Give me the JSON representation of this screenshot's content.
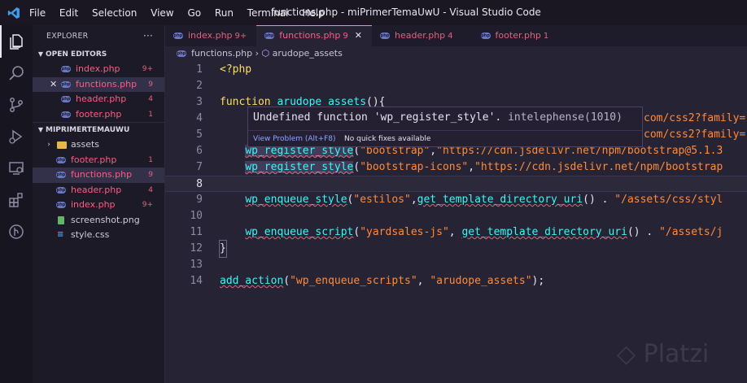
{
  "window": {
    "title": "functions.php - miPrimerTemaUwU - Visual Studio Code"
  },
  "menu": [
    "File",
    "Edit",
    "Selection",
    "View",
    "Go",
    "Run",
    "Terminal",
    "Help"
  ],
  "sidebar": {
    "title": "EXPLORER",
    "more": "···",
    "open_editors_label": "OPEN EDITORS",
    "open_editors": [
      {
        "name": "index.php",
        "badge": "9+"
      },
      {
        "name": "functions.php",
        "badge": "9"
      },
      {
        "name": "header.php",
        "badge": "4"
      },
      {
        "name": "footer.php",
        "badge": "1"
      }
    ],
    "project_label": "MIPRIMERTEMAUWU",
    "folder": "assets",
    "files": [
      {
        "name": "footer.php",
        "badge": "1"
      },
      {
        "name": "functions.php",
        "badge": "9"
      },
      {
        "name": "header.php",
        "badge": "4"
      },
      {
        "name": "index.php",
        "badge": "9+"
      },
      {
        "name": "screenshot.png",
        "badge": ""
      },
      {
        "name": "style.css",
        "badge": ""
      }
    ]
  },
  "tabs": [
    {
      "name": "index.php",
      "badge": "9+"
    },
    {
      "name": "functions.php",
      "badge": "9"
    },
    {
      "name": "header.php",
      "badge": "4"
    },
    {
      "name": "footer.php",
      "badge": "1"
    }
  ],
  "breadcrumb": {
    "file": "functions.php",
    "symbol": "arudope_assets"
  },
  "editor": {
    "line_numbers": [
      "1",
      "2",
      "3",
      "4",
      "5",
      "6",
      "7",
      "8",
      "9",
      "10",
      "11",
      "12",
      "13",
      "14"
    ],
    "l1": "<?php",
    "l3_kw": "function",
    "l3_name": "arudope_assets",
    "l3_rest": "(){",
    "l4_tail": "com/css2?family=",
    "l5_tail": "com/css2?family=",
    "l6_fn": "wp_register_style",
    "l6_a": "\"bootstrap\"",
    "l6_b": "\"https://cdn.jsdelivr.net/npm/bootstrap@5.1.3",
    "l7_fn": "wp_register_style",
    "l7_a": "\"bootstrap-icons\"",
    "l7_b": "\"https://cdn.jsdelivr.net/npm/bootstrap",
    "l9_fn": "wp_enqueue_style",
    "l9_a": "\"estilos\"",
    "l9_fn2": "get_template_directory_uri",
    "l9_b": "\"/assets/css/styl",
    "l11_fn": "wp_enqueue_script",
    "l11_a": "\"yardsales-js\"",
    "l11_fn2": "get_template_directory_uri",
    "l11_b": "\"/assets/j",
    "l12": "}",
    "l14_fn": "add_action",
    "l14_a": "\"wp_enqueue_scripts\"",
    "l14_b": "\"arudope_assets\"",
    "l14_end": ");"
  },
  "hover": {
    "message": "Undefined function 'wp_register_style'.",
    "source": "intelephense(1010)",
    "view_problem": "View Problem (Alt+F8)",
    "no_fixes": "No quick fixes available"
  },
  "watermark": "Platzi"
}
